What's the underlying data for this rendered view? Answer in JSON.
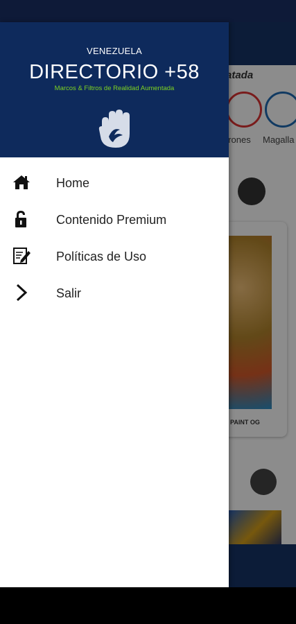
{
  "drawer": {
    "country": "VENEZUELA",
    "title": "DIRECTORIO +58",
    "subtitle": "Marcos & Filtros de Realidad Aumentada",
    "menu": [
      {
        "label": "Home",
        "icon": "home-icon"
      },
      {
        "label": "Contenido Premium",
        "icon": "unlock-icon"
      },
      {
        "label": "Políticas de Uso",
        "icon": "document-edit-icon"
      },
      {
        "label": "Salir",
        "icon": "chevron-right-icon"
      }
    ]
  },
  "background": {
    "strip_title": "atada",
    "categories": [
      "urones",
      "Magalla"
    ],
    "card_label": "PAINT OG"
  },
  "colors": {
    "header_bg": "#0e2a5c",
    "subtitle": "#7ed321",
    "status_bar": "#0e1a38"
  }
}
